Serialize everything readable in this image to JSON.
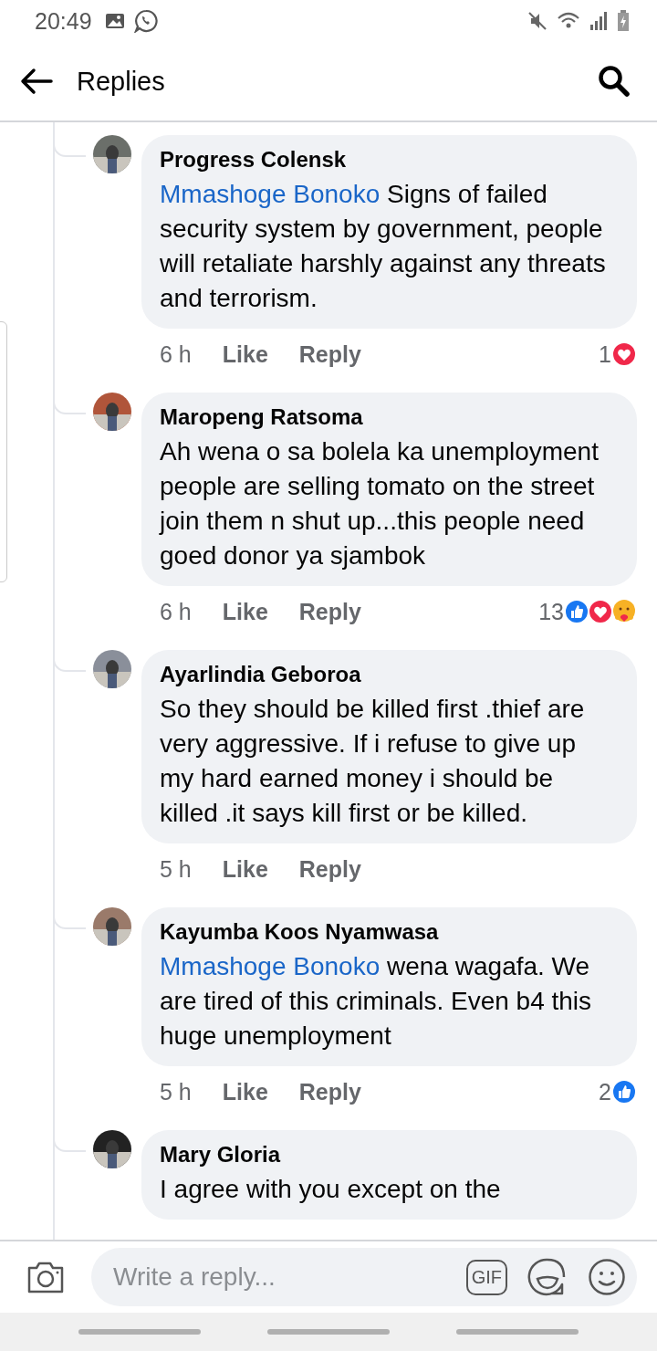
{
  "status_bar": {
    "time": "20:49"
  },
  "header": {
    "title": "Replies"
  },
  "comments": [
    {
      "author": "Progress Colensk",
      "mention": "Mmashoge Bonoko",
      "text": "Signs of failed security system by government, people will retaliate harshly against any threats and terrorism.",
      "time": "6 h",
      "like": "Like",
      "reply": "Reply",
      "reaction_count": "1",
      "reactions": [
        {
          "kind": "love"
        }
      ]
    },
    {
      "author": "Maropeng Ratsoma",
      "text": "Ah wena o sa bolela ka unemployment people  are selling tomato on the street join them n shut up...this people  need goed donor ya sjambok",
      "time": "6 h",
      "like": "Like",
      "reply": "Reply",
      "reaction_count": "13",
      "reactions": [
        {
          "kind": "like"
        },
        {
          "kind": "love"
        },
        {
          "kind": "care"
        }
      ]
    },
    {
      "author": "Ayarlindia Geboroa",
      "text": "So they should be killed first .thief are very  aggressive. If i refuse to give up my hard earned money i should be killed .it says kill first or be killed.",
      "time": "5 h",
      "like": "Like",
      "reply": "Reply"
    },
    {
      "author": "Kayumba Koos Nyamwasa",
      "mention": "Mmashoge Bonoko",
      "text": "wena wagafa. We are tired of this criminals. Even b4 this huge unemployment",
      "time": "5 h",
      "like": "Like",
      "reply": "Reply",
      "reaction_count": "2",
      "reactions": [
        {
          "kind": "like"
        }
      ]
    },
    {
      "author": "Mary Gloria",
      "text": "I agree with you except on the"
    }
  ],
  "composer": {
    "placeholder": "Write a reply...",
    "gif": "GIF"
  }
}
